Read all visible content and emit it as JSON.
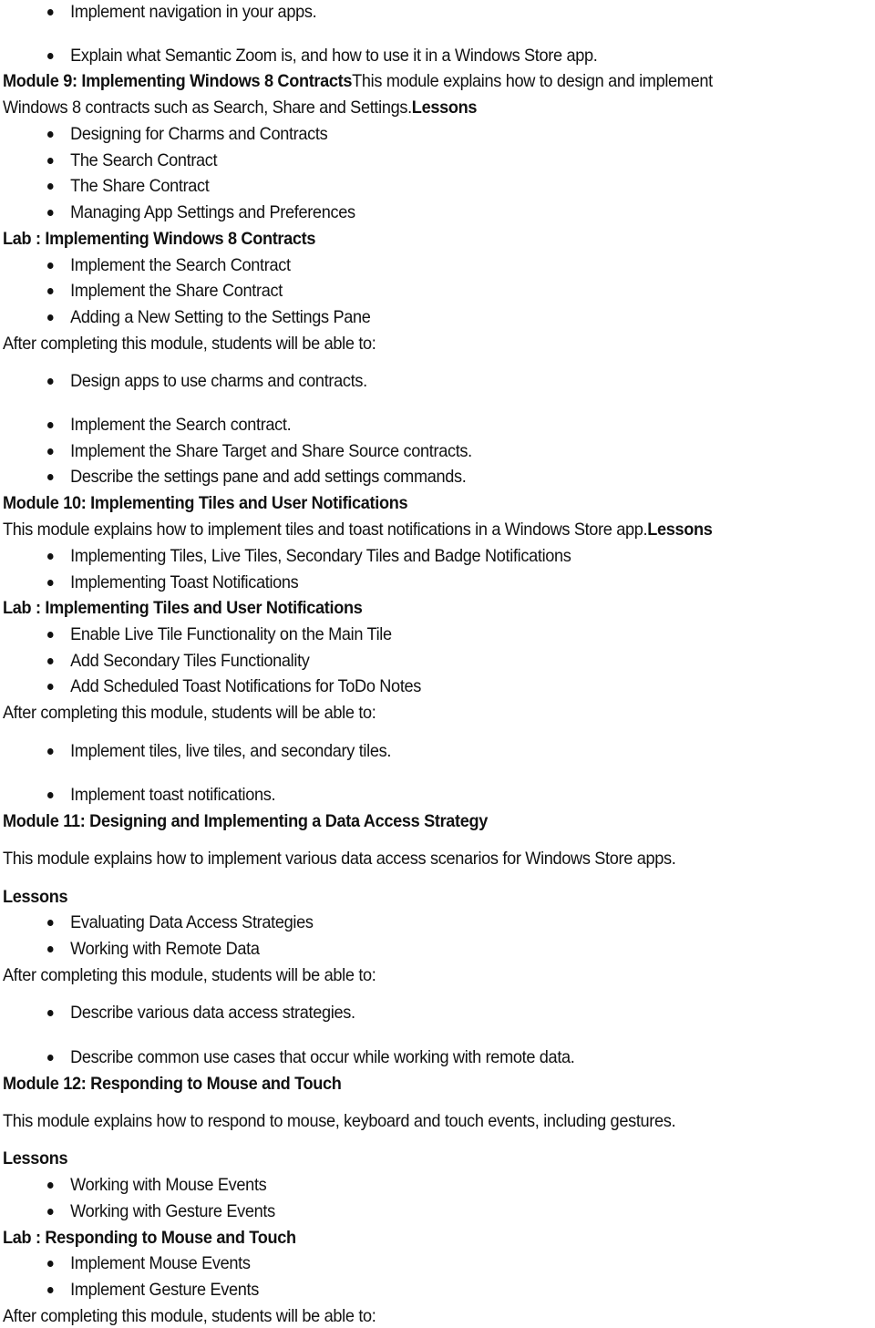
{
  "document": {
    "top_bullets": [
      "Implement navigation in your apps.",
      "Explain what Semantic Zoom is, and how to use it in a Windows Store app."
    ],
    "module9": {
      "heading": "Module 9: Implementing Windows 8 Contracts",
      "intro_part1": "This module explains how to design and implement",
      "intro_part2": "Windows 8 contracts such as Search, Share and Settings.",
      "lessons_label": "Lessons",
      "lessons": [
        "Designing for Charms and Contracts",
        "The Search Contract",
        "The Share Contract",
        "Managing App Settings and Preferences"
      ],
      "lab_heading": "Lab : Implementing Windows 8 Contracts",
      "lab_items": [
        "Implement the Search Contract",
        "Implement the Share Contract",
        "Adding a New Setting to the Settings Pane"
      ],
      "outcomes_intro": "After completing this module, students will be able to:",
      "outcomes": [
        "Design apps to use charms and contracts.",
        "Implement the Search contract.",
        "Implement the Share Target and Share Source contracts.",
        "Describe the settings pane and add settings commands."
      ]
    },
    "module10": {
      "heading": "Module 10: Implementing Tiles and User Notifications",
      "intro": "This module explains how to implement tiles and toast notifications in a Windows Store app.",
      "lessons_label": "Lessons",
      "lessons": [
        "Implementing Tiles, Live Tiles, Secondary Tiles and Badge Notifications",
        "Implementing Toast Notifications"
      ],
      "lab_heading": "Lab : Implementing Tiles and User Notifications",
      "lab_items": [
        "Enable Live Tile Functionality on the Main Tile",
        "Add Secondary Tiles Functionality",
        "Add Scheduled Toast Notifications for ToDo Notes"
      ],
      "outcomes_intro": "After completing this module, students will be able to:",
      "outcomes": [
        "Implement tiles, live tiles, and secondary tiles.",
        "Implement toast notifications."
      ]
    },
    "module11": {
      "heading": "Module 11: Designing and Implementing a Data Access Strategy",
      "intro": "This module explains how to implement various data access scenarios for Windows Store apps.",
      "lessons_label": "Lessons",
      "lessons": [
        "Evaluating Data Access Strategies",
        "Working with Remote Data"
      ],
      "outcomes_intro": "After completing this module, students will be able to:",
      "outcomes": [
        "Describe various data access strategies.",
        "Describe common use cases that occur while working with remote data."
      ]
    },
    "module12": {
      "heading": "Module 12: Responding to Mouse and Touch",
      "intro": "This module explains how to respond to mouse, keyboard and touch events, including gestures.",
      "lessons_label": "Lessons",
      "lessons": [
        "Working with Mouse Events",
        "Working with Gesture Events"
      ],
      "lab_heading": "Lab : Responding to Mouse and Touch",
      "lab_items": [
        "Implement Mouse Events",
        "Implement Gesture Events"
      ],
      "outcomes_intro": "After completing this module, students will be able to:"
    }
  }
}
